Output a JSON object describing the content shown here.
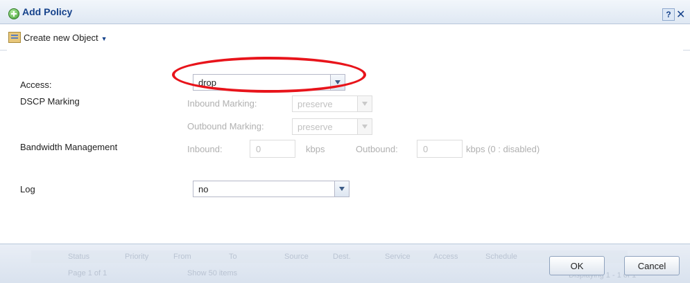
{
  "dialog": {
    "title": "Add Policy",
    "help_label": "?",
    "close_label": "✕"
  },
  "toolbar": {
    "create_object_label": "Create new Object"
  },
  "form": {
    "access_label": "Access:",
    "access_value": "drop",
    "dscp_label": "DSCP Marking",
    "inbound_marking_label": "Inbound Marking:",
    "inbound_marking_value": "preserve",
    "outbound_marking_label": "Outbound Marking:",
    "outbound_marking_value": "preserve",
    "bandwidth_label": "Bandwidth Management",
    "inbound_label": "Inbound:",
    "inbound_value": "0",
    "inbound_unit": "kbps",
    "outbound_label": "Outbound:",
    "outbound_value": "0",
    "outbound_unit": "kbps (0 : disabled)",
    "log_label": "Log",
    "log_value": "no"
  },
  "footer": {
    "ok_label": "OK",
    "cancel_label": "Cancel",
    "ghost_columns": [
      "Status",
      "Priority",
      "From",
      "To",
      "Source",
      "Dest.",
      "Service",
      "Access",
      "Schedule"
    ],
    "ghost_paging": "Page 1 of 1",
    "ghost_show": "Show 50 items",
    "ghost_display": "Displaying 1 - 1 of 1"
  },
  "colors": {
    "title_color": "#15428b",
    "highlight_color": "#e8141b"
  }
}
